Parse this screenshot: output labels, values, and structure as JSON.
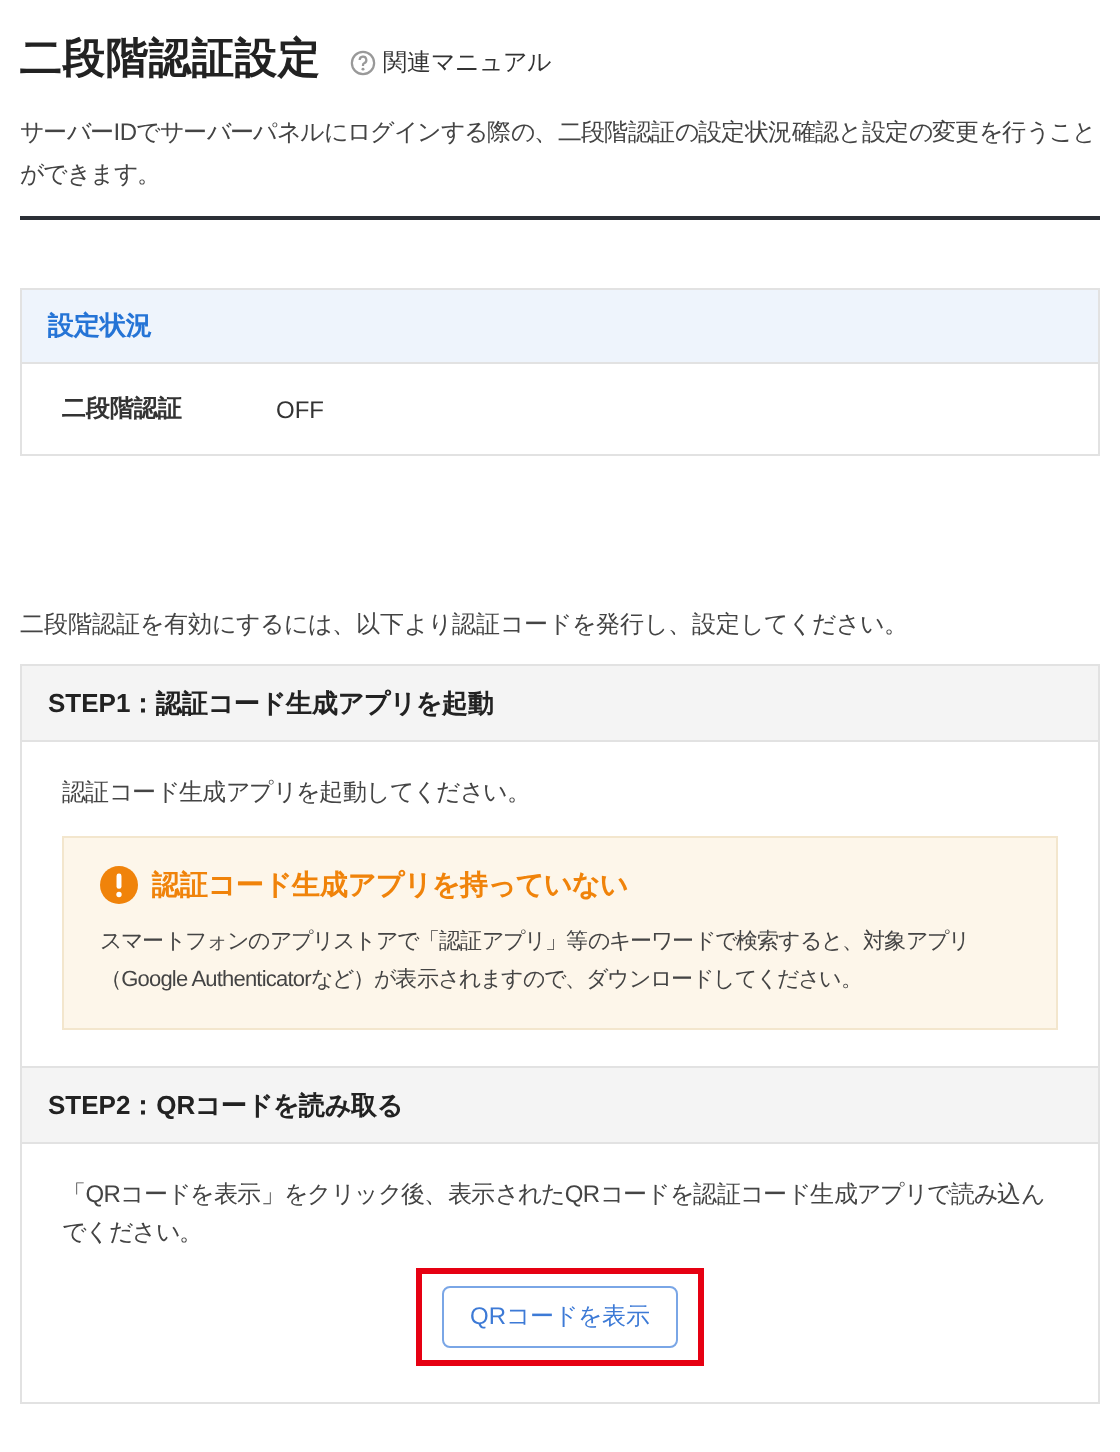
{
  "page": {
    "title": "二段階認証設定",
    "manual_link": "関連マニュアル",
    "description": "サーバーIDでサーバーパネルにログインする際の、二段階認証の設定状況確認と設定の変更を行うことができます。"
  },
  "status_panel": {
    "heading": "設定状況",
    "rows": [
      {
        "label": "二段階認証",
        "value": "OFF"
      }
    ]
  },
  "intro": "二段階認証を有効にするには、以下より認証コードを発行し、設定してください。",
  "steps": [
    {
      "heading": "STEP1：認証コード生成アプリを起動",
      "text": "認証コード生成アプリを起動してください。",
      "notice": {
        "title": "認証コード生成アプリを持っていない",
        "body": "スマートフォンのアプリストアで「認証アプリ」等のキーワードで検索すると、対象アプリ（Google Authenticatorなど）が表示されますので、ダウンロードしてください。"
      }
    },
    {
      "heading": "STEP2：QRコードを読み取る",
      "text": "「QRコードを表示」をクリック後、表示されたQRコードを認証コード生成アプリで読み込んでください。",
      "button": {
        "label": "QRコードを表示",
        "highlighted": true
      }
    }
  ]
}
